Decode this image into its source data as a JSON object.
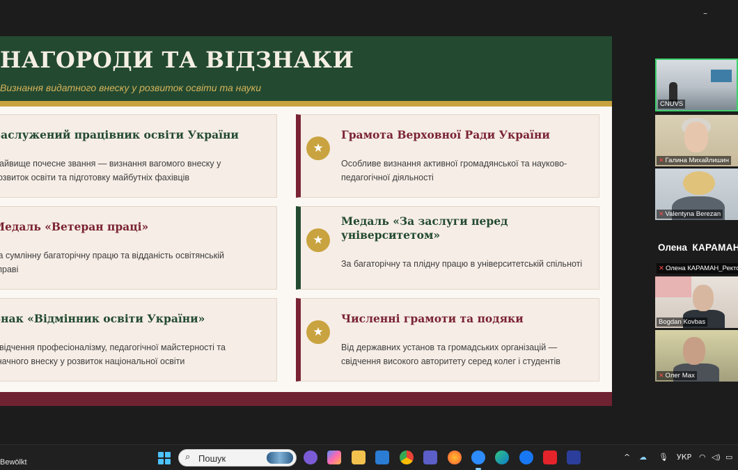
{
  "window": {
    "minimize_glyph": "–"
  },
  "slide": {
    "title": "НАГОРОДИ ТА ВІДЗНАКИ",
    "subtitle": "Визнання видатного внеску у розвиток освіти та науки",
    "cards": [
      {
        "title": "Заслужений працівник освіти України",
        "desc": "Найвище почесне звання — визнання вагомого внеску у розвиток освіти та підготовку майбутніх фахівців"
      },
      {
        "title": "Грамота Верховної Ради України",
        "desc": "Особливе визнання активної громадянської та науково-педагогічної діяльності"
      },
      {
        "title": "Медаль «Ветеран праці»",
        "desc": "За сумлінну багаторічну працю та відданість освітянській справі"
      },
      {
        "title": "Медаль «За заслуги перед університетом»",
        "desc": "За багаторічну та плідну працю в університетській спільноті"
      },
      {
        "title": "Знак «Відмінник освіти України»",
        "desc": "Свідчення професіоналізму, педагогічної майстерності та значного внеску у розвиток національної освіти"
      },
      {
        "title": "Численні грамоти та подяки",
        "desc": "Від державних установ та громадських організацій — свідчення високого авторитету серед колег і студентів"
      }
    ],
    "star_glyph": "★"
  },
  "participants": {
    "tiles": [
      {
        "label": "CNUVS"
      },
      {
        "label": "Галина Михайлишин"
      },
      {
        "label": "Valentyna Berezan"
      },
      {
        "label": "Bogdan Kovbas"
      },
      {
        "label": "Олег Мах"
      }
    ],
    "speaker_first": "Олена",
    "speaker_last": "КАРАМАН",
    "speaker_label": "Олена КАРАМАН_Ректор",
    "mic_glyph": "✕"
  },
  "taskbar": {
    "weather_text": "Bewölkt",
    "search_placeholder": "Пошук",
    "search_glyph": "⌕",
    "tray_chevron": "^",
    "tray_language": "УКР"
  },
  "colors": {
    "header_green": "#234a31",
    "accent_gold": "#c9a33f",
    "accent_burgundy": "#7a2334",
    "active_speaker": "#3dd06b"
  }
}
